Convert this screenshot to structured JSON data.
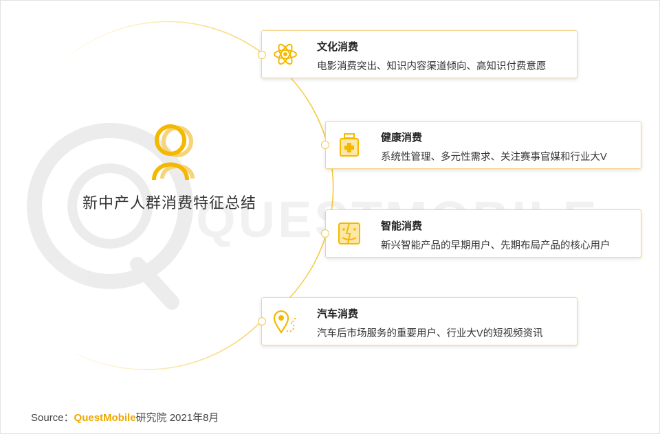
{
  "diagram": {
    "center_title": "新中产人群消费特征总结",
    "watermark_text": "QUESTMOBILE",
    "cards": [
      {
        "title": "文化消费",
        "desc": "电影消费突出、知识内容渠道倾向、高知识付费意愿",
        "icon": "atom-icon"
      },
      {
        "title": "健康消费",
        "desc": "系统性管理、多元性需求、关注赛事官媒和行业大V",
        "icon": "medicine-bottle-icon"
      },
      {
        "title": "智能消费",
        "desc": "新兴智能产品的早期用户、先期布局产品的核心用户",
        "icon": "smart-face-icon"
      },
      {
        "title": "汽车消费",
        "desc": "汽车后市场服务的重要用户、行业大V的短视频资讯",
        "icon": "location-route-icon"
      }
    ]
  },
  "source": {
    "label": "Source：",
    "brand": "QuestMobile",
    "rest": "研究院 2021年8月"
  },
  "colors": {
    "accent": "#f5b800",
    "border": "#f4d38a",
    "text": "#333333"
  }
}
